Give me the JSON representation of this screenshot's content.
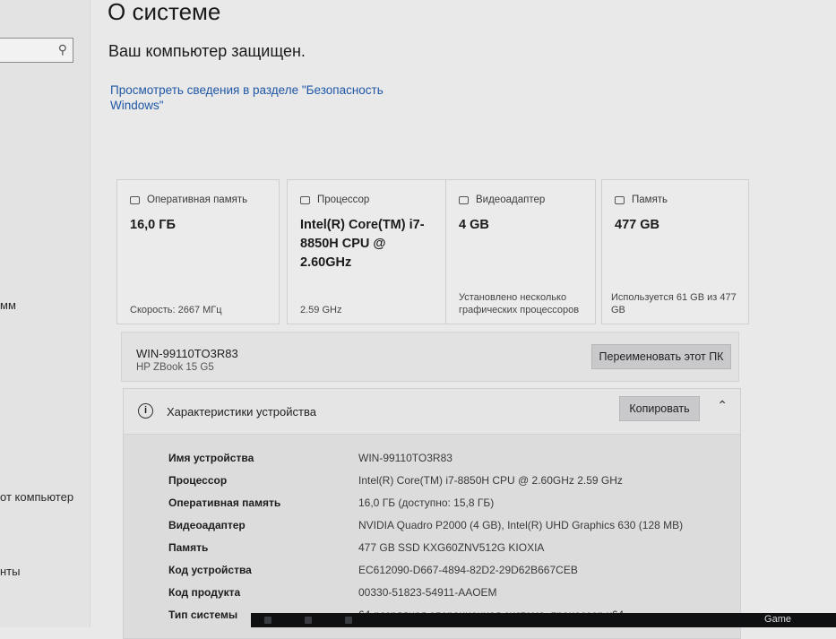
{
  "page_title": "О системе",
  "protected_text": "Ваш компьютер защищен.",
  "security_link": "Просмотреть сведения в разделе \"Безопасность Windows\"",
  "sidebar": {
    "items": [
      "мм",
      "от компьютер",
      "нты"
    ]
  },
  "cards": [
    {
      "title": "Оперативная память",
      "value": "16,0 ГБ",
      "foot": "Скорость: 2667 МГц"
    },
    {
      "title": "Процессор",
      "value": "Intel(R) Core(TM) i7-8850H CPU @ 2.60GHz",
      "foot": "2.59 GHz"
    },
    {
      "title": "Видеоадаптер",
      "value": "4 GB",
      "foot": "Установлено несколько графических процессоров"
    },
    {
      "title": "Память",
      "value": "477 GB",
      "foot": "Используется 61 GB из 477 GB"
    }
  ],
  "pc": {
    "name": "WIN-99110TO3R83",
    "model": "HP ZBook 15 G5",
    "rename_label": "Переименовать этот ПК"
  },
  "specs": {
    "title": "Характеристики устройства",
    "copy_label": "Копировать",
    "rows": [
      {
        "label": "Имя устройства",
        "value": "WIN-99110TO3R83"
      },
      {
        "label": "Процессор",
        "value": "Intel(R) Core(TM) i7-8850H CPU @ 2.60GHz   2.59 GHz"
      },
      {
        "label": "Оперативная память",
        "value": "16,0 ГБ (доступно: 15,8 ГБ)"
      },
      {
        "label": "Видеоадаптер",
        "value": "NVIDIA Quadro P2000 (4 GB), Intel(R) UHD Graphics 630 (128 MB)"
      },
      {
        "label": "Память",
        "value": "477 GB SSD KXG60ZNV512G KIOXIA"
      },
      {
        "label": "Код устройства",
        "value": "EC612090-D667-4894-82D2-29D62B667CEB"
      },
      {
        "label": "Код продукта",
        "value": "00330-51823-54911-AAOEM"
      },
      {
        "label": "Тип системы",
        "value": "64-разрядная операционная система, процессор x64"
      }
    ]
  },
  "taskbar": {
    "game_label": "Game"
  }
}
